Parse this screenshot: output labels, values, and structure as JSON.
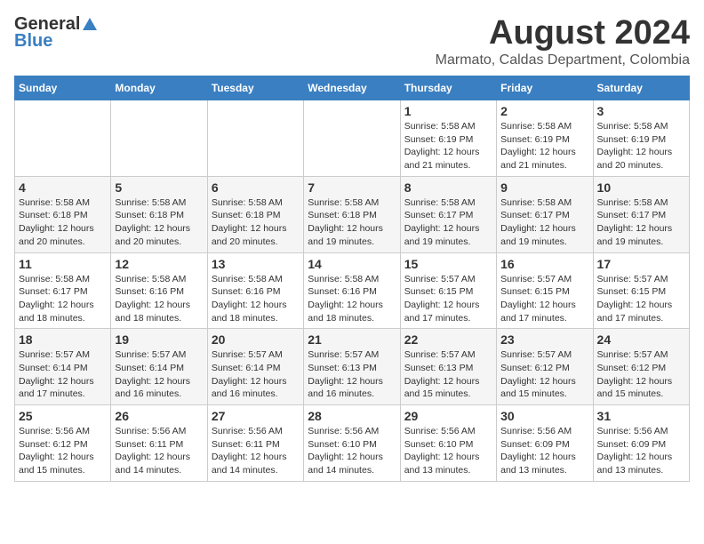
{
  "header": {
    "logo_general": "General",
    "logo_blue": "Blue",
    "title": "August 2024",
    "subtitle": "Marmato, Caldas Department, Colombia"
  },
  "days_of_week": [
    "Sunday",
    "Monday",
    "Tuesday",
    "Wednesday",
    "Thursday",
    "Friday",
    "Saturday"
  ],
  "weeks": [
    [
      {
        "day": "",
        "info": ""
      },
      {
        "day": "",
        "info": ""
      },
      {
        "day": "",
        "info": ""
      },
      {
        "day": "",
        "info": ""
      },
      {
        "day": "1",
        "info": "Sunrise: 5:58 AM\nSunset: 6:19 PM\nDaylight: 12 hours\nand 21 minutes."
      },
      {
        "day": "2",
        "info": "Sunrise: 5:58 AM\nSunset: 6:19 PM\nDaylight: 12 hours\nand 21 minutes."
      },
      {
        "day": "3",
        "info": "Sunrise: 5:58 AM\nSunset: 6:19 PM\nDaylight: 12 hours\nand 20 minutes."
      }
    ],
    [
      {
        "day": "4",
        "info": "Sunrise: 5:58 AM\nSunset: 6:18 PM\nDaylight: 12 hours\nand 20 minutes."
      },
      {
        "day": "5",
        "info": "Sunrise: 5:58 AM\nSunset: 6:18 PM\nDaylight: 12 hours\nand 20 minutes."
      },
      {
        "day": "6",
        "info": "Sunrise: 5:58 AM\nSunset: 6:18 PM\nDaylight: 12 hours\nand 20 minutes."
      },
      {
        "day": "7",
        "info": "Sunrise: 5:58 AM\nSunset: 6:18 PM\nDaylight: 12 hours\nand 19 minutes."
      },
      {
        "day": "8",
        "info": "Sunrise: 5:58 AM\nSunset: 6:17 PM\nDaylight: 12 hours\nand 19 minutes."
      },
      {
        "day": "9",
        "info": "Sunrise: 5:58 AM\nSunset: 6:17 PM\nDaylight: 12 hours\nand 19 minutes."
      },
      {
        "day": "10",
        "info": "Sunrise: 5:58 AM\nSunset: 6:17 PM\nDaylight: 12 hours\nand 19 minutes."
      }
    ],
    [
      {
        "day": "11",
        "info": "Sunrise: 5:58 AM\nSunset: 6:17 PM\nDaylight: 12 hours\nand 18 minutes."
      },
      {
        "day": "12",
        "info": "Sunrise: 5:58 AM\nSunset: 6:16 PM\nDaylight: 12 hours\nand 18 minutes."
      },
      {
        "day": "13",
        "info": "Sunrise: 5:58 AM\nSunset: 6:16 PM\nDaylight: 12 hours\nand 18 minutes."
      },
      {
        "day": "14",
        "info": "Sunrise: 5:58 AM\nSunset: 6:16 PM\nDaylight: 12 hours\nand 18 minutes."
      },
      {
        "day": "15",
        "info": "Sunrise: 5:57 AM\nSunset: 6:15 PM\nDaylight: 12 hours\nand 17 minutes."
      },
      {
        "day": "16",
        "info": "Sunrise: 5:57 AM\nSunset: 6:15 PM\nDaylight: 12 hours\nand 17 minutes."
      },
      {
        "day": "17",
        "info": "Sunrise: 5:57 AM\nSunset: 6:15 PM\nDaylight: 12 hours\nand 17 minutes."
      }
    ],
    [
      {
        "day": "18",
        "info": "Sunrise: 5:57 AM\nSunset: 6:14 PM\nDaylight: 12 hours\nand 17 minutes."
      },
      {
        "day": "19",
        "info": "Sunrise: 5:57 AM\nSunset: 6:14 PM\nDaylight: 12 hours\nand 16 minutes."
      },
      {
        "day": "20",
        "info": "Sunrise: 5:57 AM\nSunset: 6:14 PM\nDaylight: 12 hours\nand 16 minutes."
      },
      {
        "day": "21",
        "info": "Sunrise: 5:57 AM\nSunset: 6:13 PM\nDaylight: 12 hours\nand 16 minutes."
      },
      {
        "day": "22",
        "info": "Sunrise: 5:57 AM\nSunset: 6:13 PM\nDaylight: 12 hours\nand 15 minutes."
      },
      {
        "day": "23",
        "info": "Sunrise: 5:57 AM\nSunset: 6:12 PM\nDaylight: 12 hours\nand 15 minutes."
      },
      {
        "day": "24",
        "info": "Sunrise: 5:57 AM\nSunset: 6:12 PM\nDaylight: 12 hours\nand 15 minutes."
      }
    ],
    [
      {
        "day": "25",
        "info": "Sunrise: 5:56 AM\nSunset: 6:12 PM\nDaylight: 12 hours\nand 15 minutes."
      },
      {
        "day": "26",
        "info": "Sunrise: 5:56 AM\nSunset: 6:11 PM\nDaylight: 12 hours\nand 14 minutes."
      },
      {
        "day": "27",
        "info": "Sunrise: 5:56 AM\nSunset: 6:11 PM\nDaylight: 12 hours\nand 14 minutes."
      },
      {
        "day": "28",
        "info": "Sunrise: 5:56 AM\nSunset: 6:10 PM\nDaylight: 12 hours\nand 14 minutes."
      },
      {
        "day": "29",
        "info": "Sunrise: 5:56 AM\nSunset: 6:10 PM\nDaylight: 12 hours\nand 13 minutes."
      },
      {
        "day": "30",
        "info": "Sunrise: 5:56 AM\nSunset: 6:09 PM\nDaylight: 12 hours\nand 13 minutes."
      },
      {
        "day": "31",
        "info": "Sunrise: 5:56 AM\nSunset: 6:09 PM\nDaylight: 12 hours\nand 13 minutes."
      }
    ]
  ]
}
